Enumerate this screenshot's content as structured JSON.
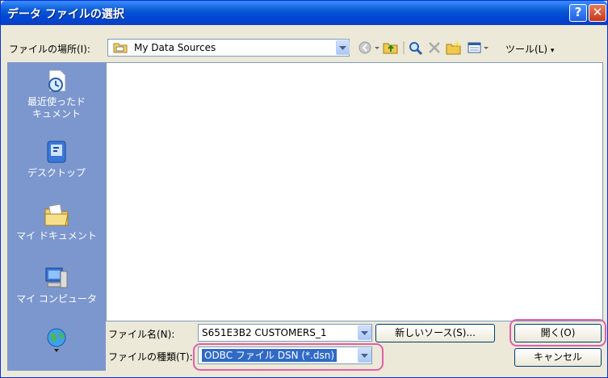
{
  "window": {
    "title": "データ ファイルの選択",
    "help_glyph": "?",
    "close_glyph": "✕"
  },
  "lookin": {
    "label": "ファイルの場所(I):",
    "value": "My Data Sources",
    "folder_icon": "folder-icon"
  },
  "toolbar": {
    "tools_label": "ツール(L)",
    "icons": [
      "back-icon",
      "up-folder-icon",
      "search-web-icon",
      "delete-icon",
      "new-folder-icon",
      "views-icon"
    ]
  },
  "places": [
    {
      "label_line1": "最近使ったド",
      "label_line2": "キュメント",
      "icon": "recent-documents-icon"
    },
    {
      "label_line1": "デスクトップ",
      "label_line2": "",
      "icon": "desktop-icon"
    },
    {
      "label_line1": "マイ ドキュメント",
      "label_line2": "",
      "icon": "my-documents-icon"
    },
    {
      "label_line1": "マイ コンピュータ",
      "label_line2": "",
      "icon": "my-computer-icon"
    },
    {
      "label_line1": "",
      "label_line2": "",
      "icon": "network-icon"
    }
  ],
  "filename": {
    "label": "ファイル名(N):",
    "value": "S651E3B2 CUSTOMERS_1"
  },
  "filetype": {
    "label": "ファイルの種類(T):",
    "value": "ODBC ファイル DSN (*.dsn)"
  },
  "buttons": {
    "new_source": "新しいソース(S)...",
    "open": "開く(O)",
    "cancel": "キャンセル"
  },
  "colors": {
    "title_bar": "#0a5ad4",
    "places_bar": "#7c97ce",
    "highlight_ring": "#e060a8",
    "selection": "#316ac5"
  }
}
